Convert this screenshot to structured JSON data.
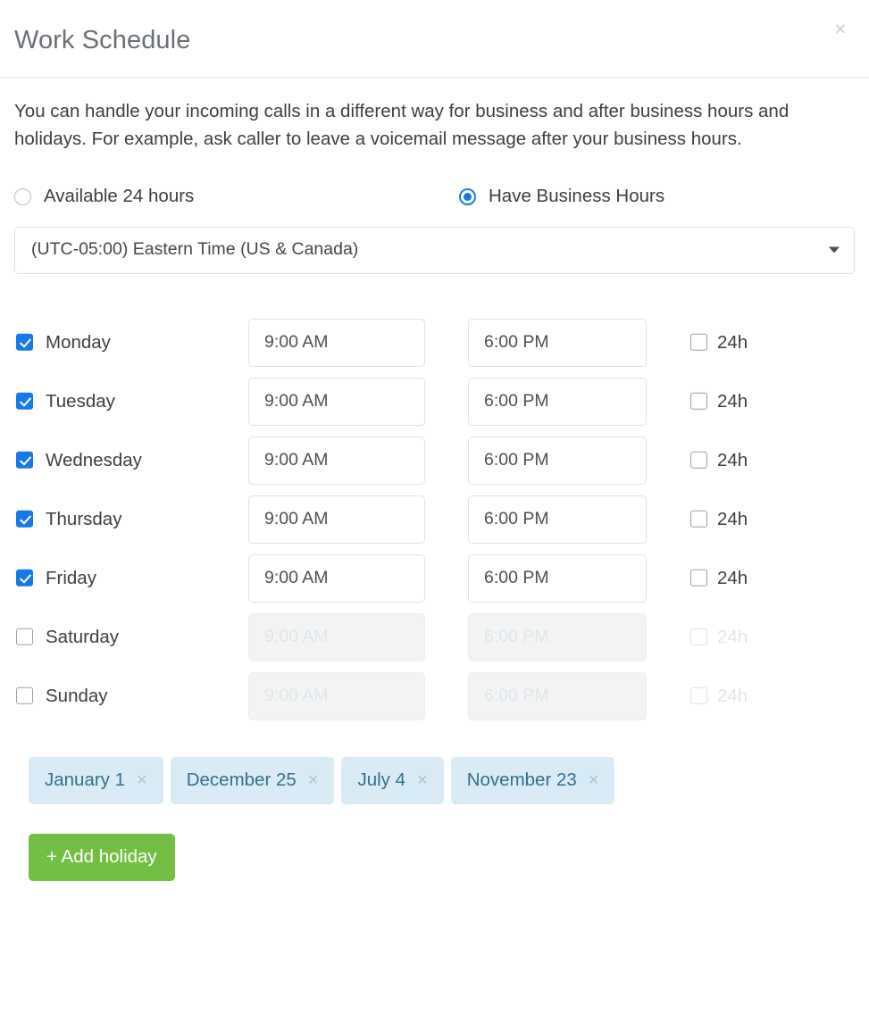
{
  "header": {
    "title": "Work Schedule",
    "close_label": "×"
  },
  "description": "You can handle your incoming calls in a different way for business and after business hours and holidays. For example, ask caller to leave a voicemail message after your business hours.",
  "availability": {
    "options": [
      {
        "label": "Available 24 hours",
        "selected": false
      },
      {
        "label": "Have Business Hours",
        "selected": true
      }
    ]
  },
  "timezone": {
    "selected": "(UTC-05:00) Eastern Time (US & Canada)"
  },
  "schedule": {
    "h24_label": "24h",
    "rows": [
      {
        "day": "Monday",
        "enabled": true,
        "start": "9:00 AM",
        "end": "6:00 PM",
        "h24": false
      },
      {
        "day": "Tuesday",
        "enabled": true,
        "start": "9:00 AM",
        "end": "6:00 PM",
        "h24": false
      },
      {
        "day": "Wednesday",
        "enabled": true,
        "start": "9:00 AM",
        "end": "6:00 PM",
        "h24": false
      },
      {
        "day": "Thursday",
        "enabled": true,
        "start": "9:00 AM",
        "end": "6:00 PM",
        "h24": false
      },
      {
        "day": "Friday",
        "enabled": true,
        "start": "9:00 AM",
        "end": "6:00 PM",
        "h24": false
      },
      {
        "day": "Saturday",
        "enabled": false,
        "start": "9:00 AM",
        "end": "6:00 PM",
        "h24": false
      },
      {
        "day": "Sunday",
        "enabled": false,
        "start": "9:00 AM",
        "end": "6:00 PM",
        "h24": false
      }
    ]
  },
  "holidays": {
    "remove_label": "×",
    "items": [
      {
        "label": "January 1"
      },
      {
        "label": "December 25"
      },
      {
        "label": "July 4"
      },
      {
        "label": "November 23"
      }
    ]
  },
  "actions": {
    "add_holiday_label": "+ Add holiday"
  },
  "colors": {
    "accent_blue": "#1779e8",
    "add_button_green": "#72bf44",
    "tag_background": "#d9ecf5",
    "tag_text": "#31708f",
    "title_gray": "#6b7075"
  }
}
